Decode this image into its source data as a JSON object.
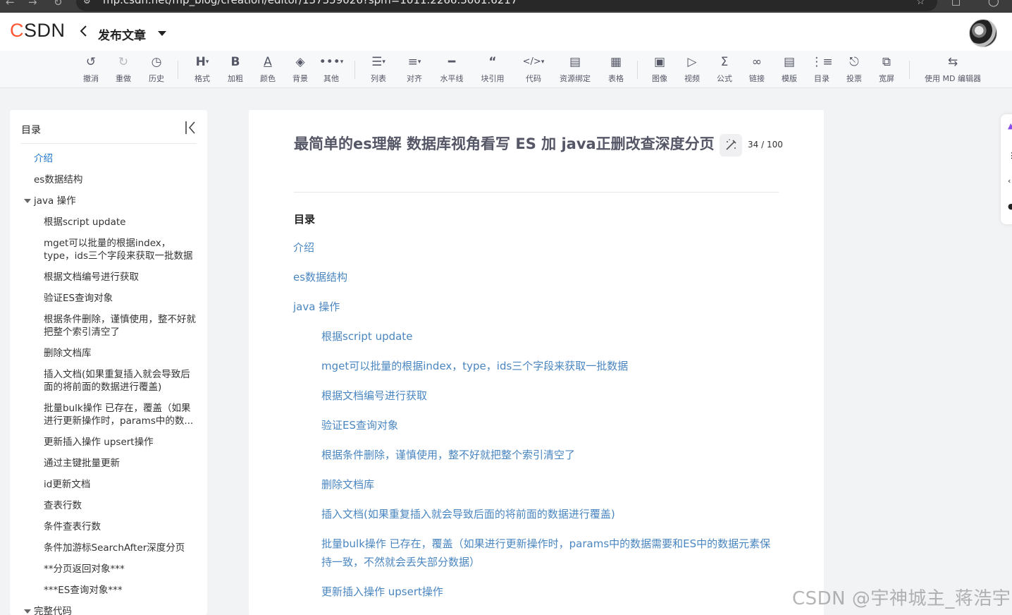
{
  "browser": {
    "url": "mp.csdn.net/mp_blog/creation/editor/137359026?spm=1011.2266.3001.6217"
  },
  "header": {
    "logo_c": "C",
    "logo_rest": "SDN",
    "page_heading": "发布文章"
  },
  "toolbar": {
    "items": [
      {
        "label": "撤消",
        "icon": "undo-icon"
      },
      {
        "label": "重做",
        "icon": "redo-icon"
      },
      {
        "label": "历史",
        "icon": "history-icon"
      },
      {
        "label": "格式",
        "icon": "heading-icon"
      },
      {
        "label": "加粗",
        "icon": "bold-icon"
      },
      {
        "label": "颜色",
        "icon": "text-color-icon"
      },
      {
        "label": "背景",
        "icon": "background-color-icon"
      },
      {
        "label": "其他",
        "icon": "more-icon"
      },
      {
        "label": "列表",
        "icon": "list-icon"
      },
      {
        "label": "对齐",
        "icon": "align-icon"
      },
      {
        "label": "水平线",
        "icon": "horizontal-line-icon"
      },
      {
        "label": "块引用",
        "icon": "quote-icon"
      },
      {
        "label": "代码",
        "icon": "code-icon"
      },
      {
        "label": "资源绑定",
        "icon": "resource-icon"
      },
      {
        "label": "表格",
        "icon": "table-icon"
      },
      {
        "label": "图像",
        "icon": "image-icon"
      },
      {
        "label": "视频",
        "icon": "video-icon"
      },
      {
        "label": "公式",
        "icon": "formula-icon"
      },
      {
        "label": "链接",
        "icon": "link-icon"
      },
      {
        "label": "模版",
        "icon": "template-icon"
      },
      {
        "label": "目录",
        "icon": "toc-icon"
      },
      {
        "label": "投票",
        "icon": "vote-icon"
      },
      {
        "label": "宽屏",
        "icon": "widescreen-icon"
      },
      {
        "label": "使用 MD 编辑器",
        "icon": "switch-editor-icon"
      }
    ]
  },
  "toc_panel": {
    "title": "目录",
    "items": [
      {
        "text": "介绍",
        "level": 1,
        "active": true
      },
      {
        "text": "es数据结构",
        "level": 1
      },
      {
        "text": "java 操作",
        "level": 1,
        "expanded": true
      },
      {
        "text": "根据script update",
        "level": 2
      },
      {
        "text": "mget可以批量的根据index，type，ids三个字段来获取一批数据",
        "level": 2
      },
      {
        "text": "根据文档编号进行获取",
        "level": 2
      },
      {
        "text": "验证ES查询对象",
        "level": 2
      },
      {
        "text": "根据条件删除，谨慎使用，整不好就把整个索引清空了",
        "level": 2
      },
      {
        "text": "删除文档库",
        "level": 2
      },
      {
        "text": "插入文档(如果重复插入就会导致后面的将前面的数据进行覆盖)",
        "level": 2
      },
      {
        "text": "批量bulk操作 已存在，覆盖（如果进行更新操作时，params中的数...",
        "level": 2
      },
      {
        "text": "更新插入操作 upsert操作",
        "level": 2
      },
      {
        "text": "通过主键批量更新",
        "level": 2
      },
      {
        "text": "id更新文档",
        "level": 2
      },
      {
        "text": "查表行数",
        "level": 2
      },
      {
        "text": "条件查表行数",
        "level": 2
      },
      {
        "text": "条件加游标SearchAfter深度分页",
        "level": 2
      },
      {
        "text": "**分页返回对象***",
        "level": 2
      },
      {
        "text": "***ES查询对象***",
        "level": 2
      },
      {
        "text": "完整代码",
        "level": 1,
        "expanded": true
      }
    ]
  },
  "editor": {
    "title": "最简单的es理解 数据库视角看写 ES 加 java正删改查深度分页",
    "title_count": "34 / 100",
    "toc_heading": "目录",
    "toc_links": [
      {
        "text": "介绍",
        "level": 1
      },
      {
        "text": "es数据结构",
        "level": 1
      },
      {
        "text": "java 操作",
        "level": 1
      },
      {
        "text": "根据script update",
        "level": 2
      },
      {
        "text": "mget可以批量的根据index，type，ids三个字段来获取一批数据",
        "level": 2
      },
      {
        "text": "根据文档编号进行获取",
        "level": 2
      },
      {
        "text": "验证ES查询对象",
        "level": 2
      },
      {
        "text": "根据条件删除，谨慎使用，整不好就把整个索引清空了",
        "level": 2
      },
      {
        "text": "删除文档库",
        "level": 2
      },
      {
        "text": "插入文档(如果重复插入就会导致后面的将前面的数据进行覆盖)",
        "level": 2
      },
      {
        "text": "批量bulk操作 已存在，覆盖（如果进行更新操作时，params中的数据需要和ES中的数据元素保持一致，不然就会丢失部分数据）",
        "level": 2
      },
      {
        "text": "更新插入操作 upsert操作",
        "level": 2
      }
    ]
  },
  "watermark": "CSDN @宇神城主_蒋浩宇",
  "colors": {
    "brand": "#fc5531",
    "link": "#4a86c0",
    "active_toc": "#1a73c8"
  }
}
